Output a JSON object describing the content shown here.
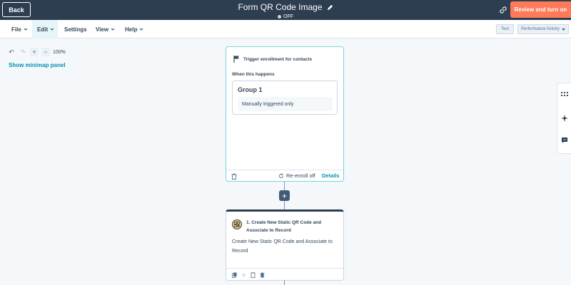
{
  "header": {
    "back_label": "Back",
    "title": "Form QR Code Image",
    "status": "OFF",
    "primary_action": "Review and turn on"
  },
  "menu": {
    "items": [
      {
        "label": "File",
        "has_dropdown": true
      },
      {
        "label": "Edit",
        "has_dropdown": true
      },
      {
        "label": "Settings",
        "has_dropdown": false
      },
      {
        "label": "View",
        "has_dropdown": true
      },
      {
        "label": "Help",
        "has_dropdown": true
      }
    ],
    "test_label": "Test",
    "performance_label": "Performance history"
  },
  "canvas": {
    "zoom_level": "100%",
    "minimap_link": "Show minimap panel"
  },
  "trigger": {
    "heading": "Trigger enrollment for contacts",
    "when_label": "When this happens",
    "group_title": "Group 1",
    "condition": "Manually triggered only",
    "reenroll_label": "Re-enroll off",
    "details_label": "Details"
  },
  "action": {
    "title": "1. Create New Static QR Code and Associate to Record",
    "description": "Create New Static QR Code and Associate to Record"
  },
  "colors": {
    "header_bg": "#2d3e50",
    "accent_orange": "#ff7a59",
    "link_teal": "#0091ae",
    "trigger_border": "#7fd1de"
  },
  "icons": [
    "pencil-icon",
    "link-icon",
    "undo-icon",
    "redo-icon",
    "zoom-in-icon",
    "zoom-out-icon",
    "flag-icon",
    "trash-icon",
    "refresh-icon",
    "plus-icon",
    "qr-code-icon",
    "copy-icon",
    "move-icon",
    "clone-icon",
    "grid-icon",
    "sparkle-icon",
    "chat-icon"
  ]
}
